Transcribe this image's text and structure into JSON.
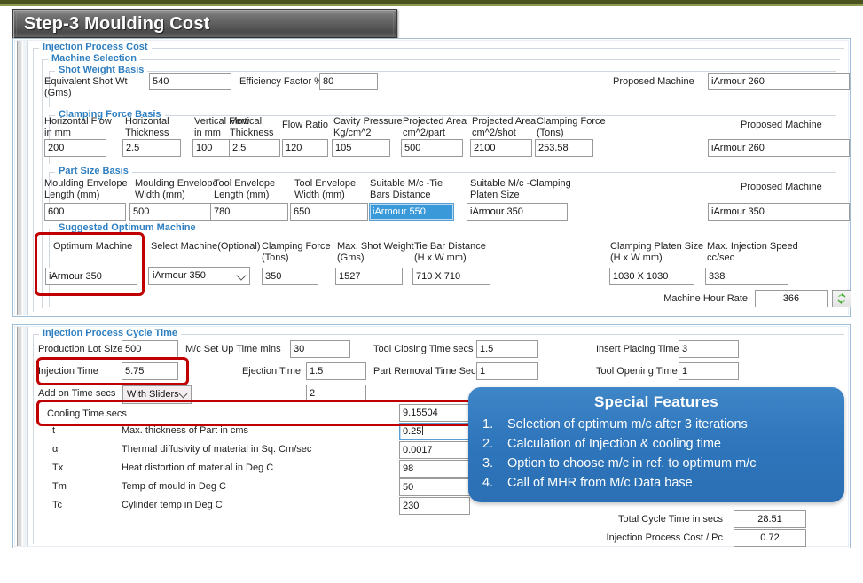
{
  "header": {
    "title": "Step-3  Moulding Cost"
  },
  "panel_a": {
    "group_injection_process_cost": "Injection Process Cost",
    "group_machine_selection": "Machine Selection",
    "group_shot_weight_basis": "Shot Weight Basis",
    "group_clamping_force_basis": "Clamping Force Basis",
    "group_part_size_basis": "Part Size Basis",
    "group_suggested_optimum_machine": "Suggested Optimum Machine",
    "shot_weight": {
      "equivalent_shot_wt_label": "Equivalent Shot Wt (Gms)",
      "equivalent_shot_wt_value": "540",
      "efficiency_factor_label": "Efficiency Factor %",
      "efficiency_factor_value": "80",
      "proposed_machine_label": "Proposed Machine",
      "proposed_machine_value": "iArmour 260"
    },
    "clamping_force": {
      "labels": [
        "Horizontal Flow\nin mm",
        "Horizontal\nThickness",
        "Vertical Flow\nin mm",
        "Vertical\nThickness",
        "Flow Ratio",
        "Cavity Pressure\nKg/cm^2",
        "Projected Area\ncm^2/part",
        "Projected Area\ncm^2/shot",
        "Clamping Force\n(Tons)"
      ],
      "values": [
        "200",
        "2.5",
        "100",
        "2.5",
        "120",
        "105",
        "500",
        "2100",
        "253.58"
      ],
      "proposed_machine_label": "Proposed Machine",
      "proposed_machine_value": "iArmour 260"
    },
    "part_size": {
      "labels": [
        "Moulding Envelope\nLength (mm)",
        "Moulding Envelope\nWidth (mm)",
        "Tool Envelope\nLength (mm)",
        "Tool Envelope\nWidth (mm)",
        "Suitable M/c -Tie\nBars Distance",
        "Suitable M/c -Clamping\nPlaten Size"
      ],
      "values": [
        "600",
        "500",
        "780",
        "650",
        "iArmour 550",
        "iArmour 350"
      ],
      "proposed_machine_label": "Proposed Machine",
      "proposed_machine_value": "iArmour 350"
    },
    "optimum": {
      "optimum_machine_label": "Optimum Machine",
      "optimum_machine_value": "iArmour 350",
      "select_machine_label": "Select Machine(Optional)",
      "select_machine_value": "iArmour 350",
      "clamping_force_label": "Clamping Force\n(Tons)",
      "clamping_force_value": "350",
      "max_shot_weight_label": "Max. Shot Weight\n(Gms)",
      "max_shot_weight_value": "1527",
      "tie_bar_distance_label": "Tie Bar Distance\n(H x W mm)",
      "tie_bar_distance_value": "710 X 710",
      "clamping_platen_size_label": "Clamping Platen Size\n(H x W mm)",
      "clamping_platen_size_value": "1030 X 1030",
      "max_injection_speed_label": "Max. Injection Speed\ncc/sec",
      "max_injection_speed_value": "338",
      "machine_hour_rate_label": "Machine Hour Rate",
      "machine_hour_rate_value": "366",
      "refresh_icon": "refresh-icon"
    }
  },
  "panel_b": {
    "group_cycle_time": "Injection Process Cycle Time",
    "rows": {
      "production_lot_size_label": "Production Lot Size",
      "production_lot_size_value": "500",
      "mc_setup_time_label": "M/c Set Up Time  mins",
      "mc_setup_time_value": "30",
      "tool_closing_time_label": "Tool Closing Time secs",
      "tool_closing_time_value": "1.5",
      "insert_placing_time_label": "Insert Placing Time",
      "insert_placing_time_value": "3",
      "injection_time_label": "Injection Time",
      "injection_time_value": "5.75",
      "ejection_time_label": "Ejection Time",
      "ejection_time_value": "1.5",
      "part_removal_time_label": "Part Removal Time Secs",
      "part_removal_time_value": "1",
      "tool_opening_time_label": "Tool Opening Time",
      "tool_opening_time_value": "1",
      "add_on_time_label": "Add on Time secs",
      "add_on_time_option": "With Sliders",
      "add_on_time_value": "2",
      "cooling_time_label": "Cooling Time secs",
      "cooling_time_value": "9.15504"
    },
    "params": [
      {
        "symbol": "t",
        "description": "Max. thickness of Part in cms",
        "value": "0.25"
      },
      {
        "symbol": "α",
        "description": "Thermal diffusivity of material in Sq. Cm/sec",
        "value": "0.0017"
      },
      {
        "symbol": "Tx",
        "description": "Heat distortion of material in Deg C",
        "value": "98"
      },
      {
        "symbol": "Tm",
        "description": "Temp of mould in Deg C",
        "value": "50"
      },
      {
        "symbol": "Tc",
        "description": "Cylinder temp in Deg C",
        "value": "230"
      }
    ],
    "totals": {
      "total_cycle_time_label": "Total Cycle Time in secs",
      "total_cycle_time_value": "28.51",
      "injection_process_cost_label": "Injection Process Cost / Pc",
      "injection_process_cost_value": "0.72"
    }
  },
  "callout": {
    "title": "Special Features",
    "items": [
      {
        "num": "1.",
        "text": "Selection of optimum m/c after 3 iterations"
      },
      {
        "num": "2.",
        "text": "Calculation of Injection & cooling time"
      },
      {
        "num": "3.",
        "text": "Option to choose m/c  in ref. to optimum m/c"
      },
      {
        "num": "4.",
        "text": "Call of MHR  from M/c Data base"
      }
    ]
  },
  "colors": {
    "group_title": "#2f7fc1",
    "annotation_red": "#c00000",
    "callout_blue": "#2f76bc",
    "top_strip_olive": "#4a5320",
    "selection_blue": "#3a9ad9"
  }
}
